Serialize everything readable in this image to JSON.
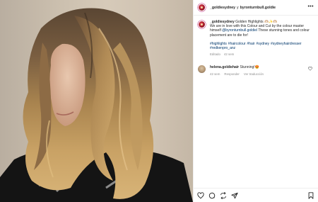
{
  "header": {
    "username": "_goldiesydney",
    "separator": "y",
    "collaborator": "byronturnbull.goldie",
    "more_label": "•••"
  },
  "caption": {
    "username": "_goldiesydney",
    "text_start": " Golden Highlights 🫶🏼✨🫶🏼",
    "line2": "We are in love with this Colour and Cut by the colour master himself ",
    "mention": "@byronturnbull.goldiel",
    "text_end": " These stunning tones and colour placement are to die for!",
    "hashtags": "#highlights #haircolour #hair #sydney #sydneyhairdresser #redkenpro_anz",
    "edited_label": "Editado",
    "time": "42 sem"
  },
  "reply": {
    "username": "helena.goldiehair",
    "text": "Stunning!😍",
    "time": "42 sem",
    "reply_label": "Responder",
    "translate_label": "Ver traducción"
  },
  "actions": {
    "icons": [
      "heart-icon",
      "comment-icon",
      "share-icon",
      "send-icon",
      "bookmark-icon"
    ]
  },
  "colors": {
    "link": "#00376b",
    "muted": "#8e8e8e",
    "text": "#262626",
    "border": "#efefef"
  }
}
